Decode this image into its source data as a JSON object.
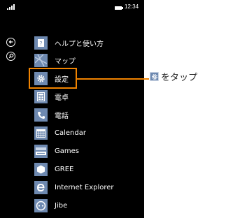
{
  "status_bar": {
    "time": "12:34",
    "signal_icon": "signal-bars-icon",
    "battery_icon": "battery-icon"
  },
  "side_buttons": [
    {
      "icon": "back-arrow-icon"
    },
    {
      "icon": "search-icon"
    }
  ],
  "apps": [
    {
      "label": "ヘルプと使い方",
      "icon": "help-icon",
      "tile_color": "#6e89b0"
    },
    {
      "label": "マップ",
      "icon": "map-icon",
      "tile_color": "#6e89b0"
    },
    {
      "label": "設定",
      "icon": "gear-icon",
      "tile_color": "#6e89b0",
      "highlighted": true
    },
    {
      "label": "電卓",
      "icon": "calculator-icon",
      "tile_color": "#6e89b0"
    },
    {
      "label": "電話",
      "icon": "phone-icon",
      "tile_color": "#6e89b0"
    },
    {
      "label": "Calendar",
      "icon": "calendar-icon",
      "tile_color": "#6e89b0"
    },
    {
      "label": "Games",
      "icon": "xbox-live-icon",
      "tile_color": "#6e89b0"
    },
    {
      "label": "GREE",
      "icon": "gree-icon",
      "tile_color": "#6e89b0"
    },
    {
      "label": "Internet Explorer",
      "icon": "internet-explorer-icon",
      "tile_color": "#6e89b0"
    },
    {
      "label": "Jibe",
      "icon": "jibe-icon",
      "tile_color": "#6e89b0"
    }
  ],
  "highlight_color": "#f08300",
  "callout": {
    "icon": "gear-icon",
    "text": "をタップ"
  }
}
